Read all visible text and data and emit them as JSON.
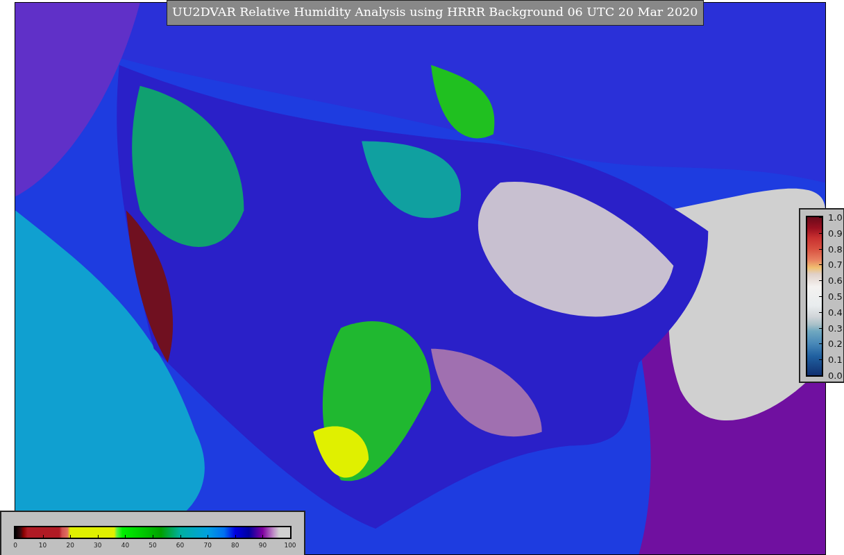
{
  "title": "UU2DVAR Relative Humidity Analysis using HRRR Background 06 UTC 20 Mar 2020",
  "colorbars": [
    {
      "kind": "vertical",
      "ticks": [
        "1.0",
        "0.9",
        "0.8",
        "0.7",
        "0.6",
        "0.5",
        "0.4",
        "0.3",
        "0.2",
        "0.1",
        "0.0"
      ]
    },
    {
      "kind": "horizontal",
      "ticks": [
        "0",
        "10",
        "20",
        "30",
        "40",
        "50",
        "60",
        "70",
        "80",
        "90",
        "100"
      ]
    }
  ]
}
